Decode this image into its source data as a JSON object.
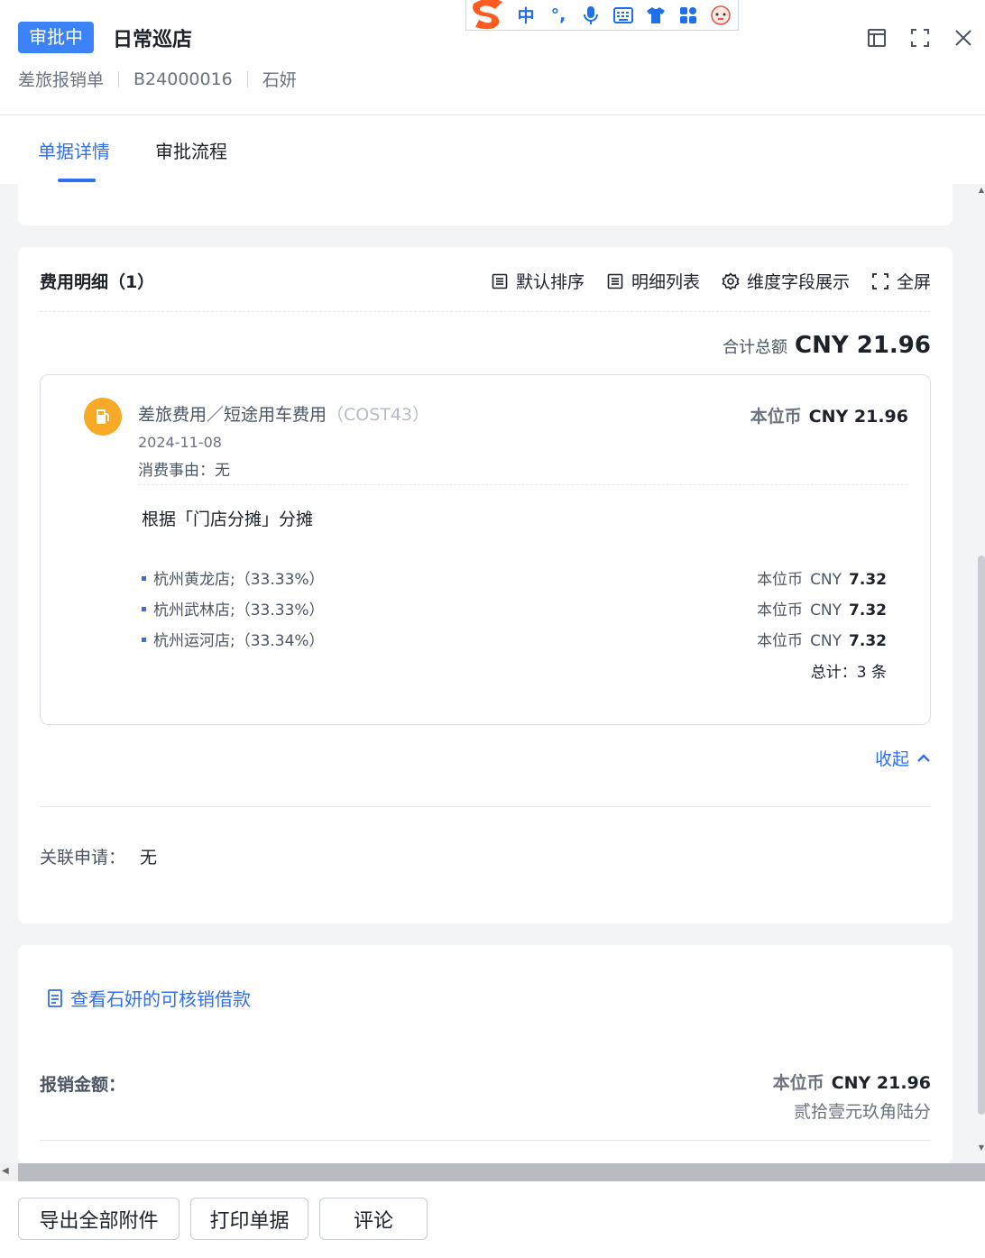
{
  "header": {
    "status": "审批中",
    "title": "日常巡店",
    "form_type": "差旅报销单",
    "doc_no": "B24000016",
    "applicant": "石妍"
  },
  "ime": {
    "lang": "中",
    "punct": "°,"
  },
  "tabs": [
    {
      "label": "单据详情",
      "active": true
    },
    {
      "label": "审批流程",
      "active": false
    }
  ],
  "expenses": {
    "title": "费用明细（1）",
    "tools": [
      "默认排序",
      "明细列表",
      "维度字段展示",
      "全屏"
    ],
    "total_label": "合计总额",
    "total_value": "CNY 21.96",
    "item": {
      "name": "差旅费用／短途用车费用",
      "code": "（COST43）",
      "amount_label": "本位币",
      "amount": "CNY 21.96",
      "date": "2024-11-08",
      "reason": "消费事由：无",
      "alloc_title": "根据「门店分摊」分摊",
      "allocations": [
        {
          "store": "杭州黄龙店;（33.33%）",
          "label": "本位币",
          "currency": "CNY",
          "value": "7.32"
        },
        {
          "store": "杭州武林店;（33.33%）",
          "label": "本位币",
          "currency": "CNY",
          "value": "7.32"
        },
        {
          "store": "杭州运河店;（33.34%）",
          "label": "本位币",
          "currency": "CNY",
          "value": "7.32"
        }
      ],
      "alloc_total": "总计：3 条"
    },
    "collapse_label": "收起",
    "related_label": "关联申请：",
    "related_value": "无"
  },
  "loan": {
    "link_label": "查看石妍的可核销借款",
    "reimb_label": "报销金额：",
    "reimb_currency_label": "本位币",
    "reimb_amount": "CNY 21.96",
    "reimb_words": "贰拾壹元玖角陆分"
  },
  "footer": {
    "export_label": "导出全部附件",
    "print_label": "打印单据",
    "comment_label": "评论"
  },
  "colors": {
    "accent": "#2f6ff0",
    "badge": "#3b82f6",
    "item_icon": "#f7a928"
  }
}
